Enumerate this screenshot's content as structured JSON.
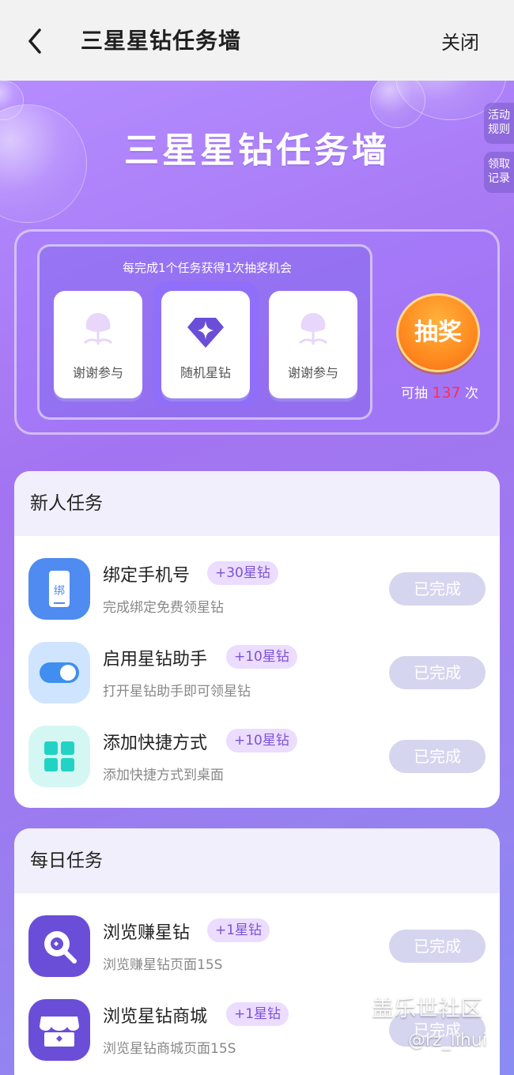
{
  "nav": {
    "title": "三星星钻任务墙",
    "close_label": "关闭",
    "back_icon": "chevron-left-icon"
  },
  "side_buttons": {
    "rules": "活动\n规则",
    "records": "领取\n记录"
  },
  "hero": {
    "title": "三星星钻任务墙"
  },
  "lottery": {
    "hint": "每完成1个任务获得1次抽奖机会",
    "prizes": [
      {
        "label": "谢谢参与",
        "icon": "sprout-icon"
      },
      {
        "label": "随机星钻",
        "icon": "star-diamond-icon"
      },
      {
        "label": "谢谢参与",
        "icon": "sprout-icon"
      }
    ],
    "draw_label": "抽奖",
    "count_prefix": "可抽",
    "count": "137",
    "count_suffix": "次"
  },
  "new_tasks": {
    "header": "新人任务",
    "items": [
      {
        "title": "绑定手机号",
        "badge": "+30星钻",
        "desc": "完成绑定免费领星钻",
        "button": "已完成",
        "icon": "phone-bind-icon"
      },
      {
        "title": "启用星钻助手",
        "badge": "+10星钻",
        "desc": "打开星钻助手即可领星钻",
        "button": "已完成",
        "icon": "toggle-icon"
      },
      {
        "title": "添加快捷方式",
        "badge": "+10星钻",
        "desc": "添加快捷方式到桌面",
        "button": "已完成",
        "icon": "grid-icon"
      }
    ]
  },
  "daily_tasks": {
    "header": "每日任务",
    "items": [
      {
        "title": "浏览赚星钻",
        "badge": "+1星钻",
        "desc": "浏览赚星钻页面15S",
        "button": "已完成",
        "icon": "browse-search-icon"
      },
      {
        "title": "浏览星钻商城",
        "badge": "+1星钻",
        "desc": "浏览星钻商城页面15S",
        "button": "已完成",
        "icon": "store-icon"
      }
    ]
  },
  "watermark": {
    "line1": "盖乐世社区",
    "line2": "@rz_lihui"
  },
  "colors": {
    "accent": "#a374f1",
    "badge_text": "#7b52d6",
    "draw_orange": "#ff8a1f",
    "count_red": "#ff2d55"
  }
}
